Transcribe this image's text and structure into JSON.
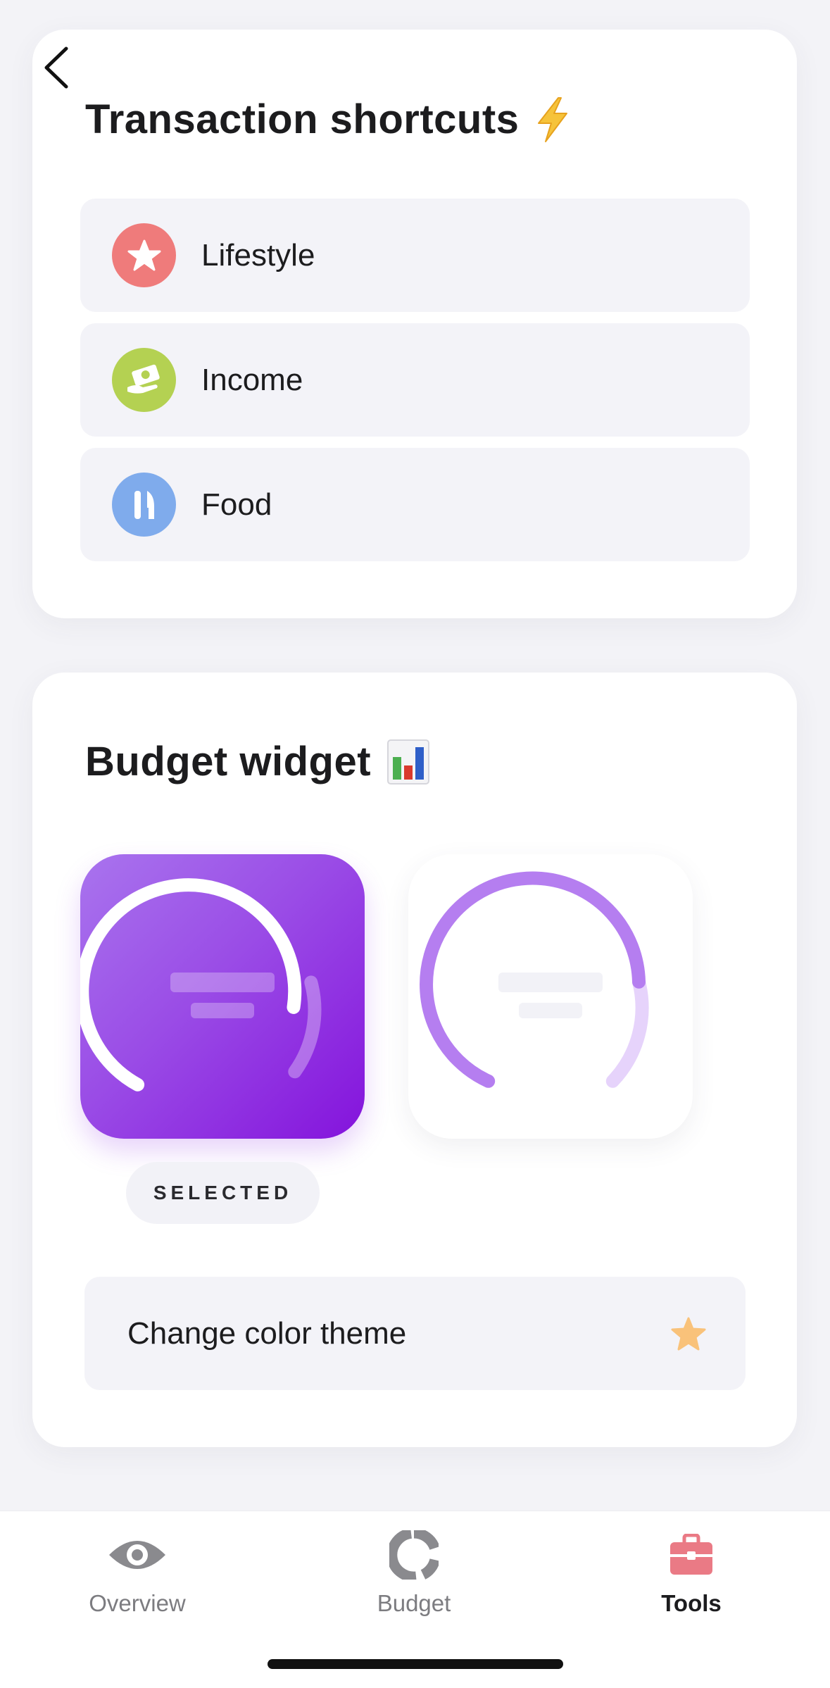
{
  "shortcuts": {
    "title": "Transaction shortcuts",
    "title_emoji_icon": "lightning-bolt-icon",
    "items": [
      {
        "label": "Lifestyle",
        "icon": "star-icon",
        "color": "#ef7b7b"
      },
      {
        "label": "Income",
        "icon": "money-icon",
        "color": "#b4d152"
      },
      {
        "label": "Food",
        "icon": "fork-knife-icon",
        "color": "#7fabec"
      }
    ]
  },
  "widget": {
    "title": "Budget widget",
    "title_emoji_icon": "bar-chart-icon",
    "options": [
      {
        "name": "purple",
        "selected": true
      },
      {
        "name": "white",
        "selected": false
      }
    ],
    "selected_label": "SELECTED",
    "theme_button_label": "Change color theme",
    "theme_icon": "star-icon",
    "accent_color": "#9a4ce6"
  },
  "tabbar": {
    "tabs": [
      {
        "label": "Overview",
        "icon": "eye-icon",
        "active": false
      },
      {
        "label": "Budget",
        "icon": "donut-chart-icon",
        "active": false
      },
      {
        "label": "Tools",
        "icon": "toolbox-icon",
        "active": true
      }
    ],
    "active_color": "#ea7a85"
  }
}
